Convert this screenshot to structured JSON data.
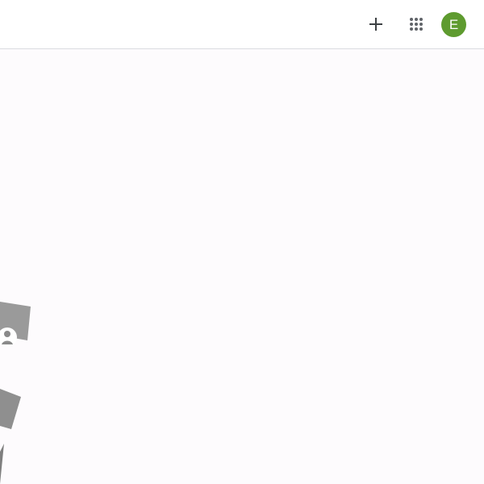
{
  "header": {
    "add_icon": "plus-icon",
    "apps_icon": "apps-grid-icon",
    "avatar_initial": "E",
    "avatar_color": "#5e9b2f"
  },
  "main": {
    "illustration_icon": "user-card-illustration"
  }
}
